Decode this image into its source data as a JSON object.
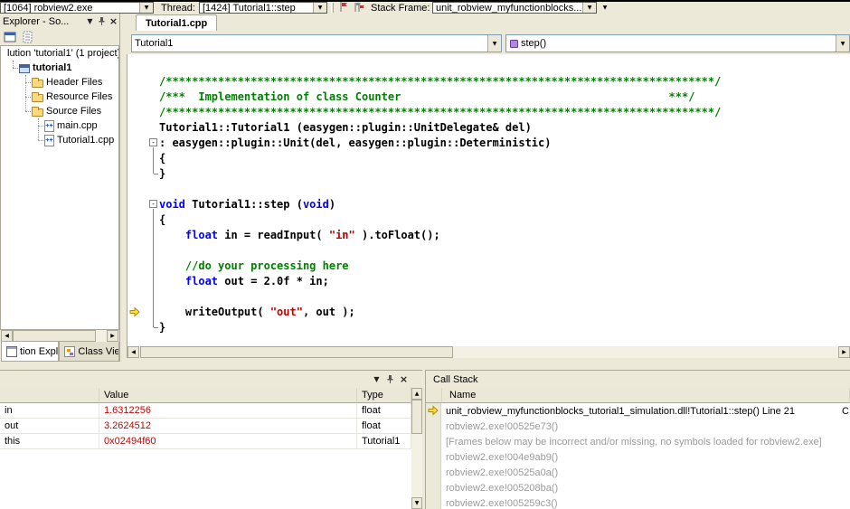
{
  "colors": {
    "keyword": "#0000ff",
    "comment": "#008000",
    "string": "#c00000",
    "changed_value": "#cc0000",
    "current_arrow": "#ffdd3c",
    "inactive_frame": "#9b9b9b"
  },
  "debug_toolbar": {
    "process": "[1064] robview2.exe",
    "thread_label": "Thread:",
    "thread": "[1424] Tutorial1::step",
    "stack_frame_label": "Stack Frame:",
    "stack_frame": "unit_robview_myfunctionblocks..."
  },
  "document_tab": {
    "label": "Tutorial1.cpp"
  },
  "solution_explorer": {
    "title": "Explorer - So...",
    "items": [
      {
        "label": "lution 'tutorial1' (1 project)",
        "icon": null,
        "indent": 0,
        "bold": false
      },
      {
        "label": "tutorial1",
        "icon": "project",
        "indent": 1,
        "bold": true
      },
      {
        "label": "Header Files",
        "icon": "folder",
        "indent": 2,
        "bold": false
      },
      {
        "label": "Resource Files",
        "icon": "folder",
        "indent": 2,
        "bold": false
      },
      {
        "label": "Source Files",
        "icon": "folder",
        "indent": 2,
        "bold": false
      },
      {
        "label": "main.cpp",
        "icon": "cpp",
        "indent": 3,
        "bold": false
      },
      {
        "label": "Tutorial1.cpp",
        "icon": "cpp",
        "indent": 3,
        "bold": false
      }
    ],
    "bottom_tabs": [
      {
        "label": "tion Expl...",
        "icon": "solution-explorer",
        "active": true
      },
      {
        "label": "Class View",
        "icon": "class-view",
        "active": false
      }
    ]
  },
  "editor": {
    "type_dropdown": "Tutorial1",
    "member_dropdown": "step()",
    "lines": [
      {
        "tokens": [
          {
            "t": "/************************************************************************************/",
            "c": "comment"
          }
        ]
      },
      {
        "tokens": [
          {
            "t": "/***  Implementation of class Counter                                         ***/",
            "c": "comment"
          }
        ]
      },
      {
        "tokens": [
          {
            "t": "/************************************************************************************/",
            "c": "comment"
          }
        ]
      },
      {
        "tokens": [
          {
            "t": "Tutorial1::Tutorial1 (easygen::plugin::UnitDelegate& del)",
            "c": "plain"
          }
        ]
      },
      {
        "tokens": [
          {
            "t": ": easygen::plugin::Unit(del, easygen::plugin::Deterministic)",
            "c": "plain"
          }
        ],
        "fold": "minus",
        "fold_end": 6
      },
      {
        "tokens": [
          {
            "t": "{",
            "c": "plain"
          }
        ]
      },
      {
        "tokens": [
          {
            "t": "}",
            "c": "plain"
          }
        ]
      },
      {
        "tokens": []
      },
      {
        "tokens": [
          {
            "t": "void",
            "c": "keyword"
          },
          {
            "t": " Tutorial1::step (",
            "c": "plain"
          },
          {
            "t": "void",
            "c": "keyword"
          },
          {
            "t": ")",
            "c": "plain"
          }
        ],
        "fold": "minus",
        "fold_end": 16
      },
      {
        "tokens": [
          {
            "t": "{",
            "c": "plain"
          }
        ]
      },
      {
        "tokens": [
          {
            "t": "    ",
            "c": "plain"
          },
          {
            "t": "float",
            "c": "keyword"
          },
          {
            "t": " in = readInput( ",
            "c": "plain"
          },
          {
            "t": "\"in\"",
            "c": "string"
          },
          {
            "t": " ).toFloat();",
            "c": "plain"
          }
        ]
      },
      {
        "tokens": []
      },
      {
        "tokens": [
          {
            "t": "    //do your processing here",
            "c": "comment"
          }
        ]
      },
      {
        "tokens": [
          {
            "t": "    ",
            "c": "plain"
          },
          {
            "t": "float",
            "c": "keyword"
          },
          {
            "t": " out = 2.0f * in;",
            "c": "plain"
          }
        ]
      },
      {
        "tokens": []
      },
      {
        "tokens": [
          {
            "t": "    writeOutput( ",
            "c": "plain"
          },
          {
            "t": "\"out\"",
            "c": "string"
          },
          {
            "t": ", out );",
            "c": "plain"
          }
        ],
        "current": true
      },
      {
        "tokens": [
          {
            "t": "}",
            "c": "plain"
          }
        ]
      }
    ]
  },
  "watch_panel": {
    "columns": {
      "name": "",
      "value": "Value",
      "type": "Type"
    },
    "rows": [
      {
        "name": "in",
        "value": "1.6312256",
        "type": "float"
      },
      {
        "name": "out",
        "value": "3.2624512",
        "type": "float"
      },
      {
        "name": "this",
        "value": "0x02494f60",
        "type": "Tutorial1"
      }
    ]
  },
  "call_stack": {
    "title": "Call Stack",
    "name_column": "Name",
    "frames": [
      {
        "text": "unit_robview_myfunctionblocks_tutorial1_simulation.dll!Tutorial1::step()  Line 21",
        "current": true,
        "lang": "C"
      },
      {
        "text": "robview2.exe!00525e73()"
      },
      {
        "text": "[Frames below may be incorrect and/or missing, no symbols loaded for robview2.exe]"
      },
      {
        "text": "robview2.exe!004e9ab9()"
      },
      {
        "text": "robview2.exe!00525a0a()"
      },
      {
        "text": "robview2.exe!005208ba()"
      },
      {
        "text": "robview2.exe!005259c3()"
      }
    ]
  }
}
